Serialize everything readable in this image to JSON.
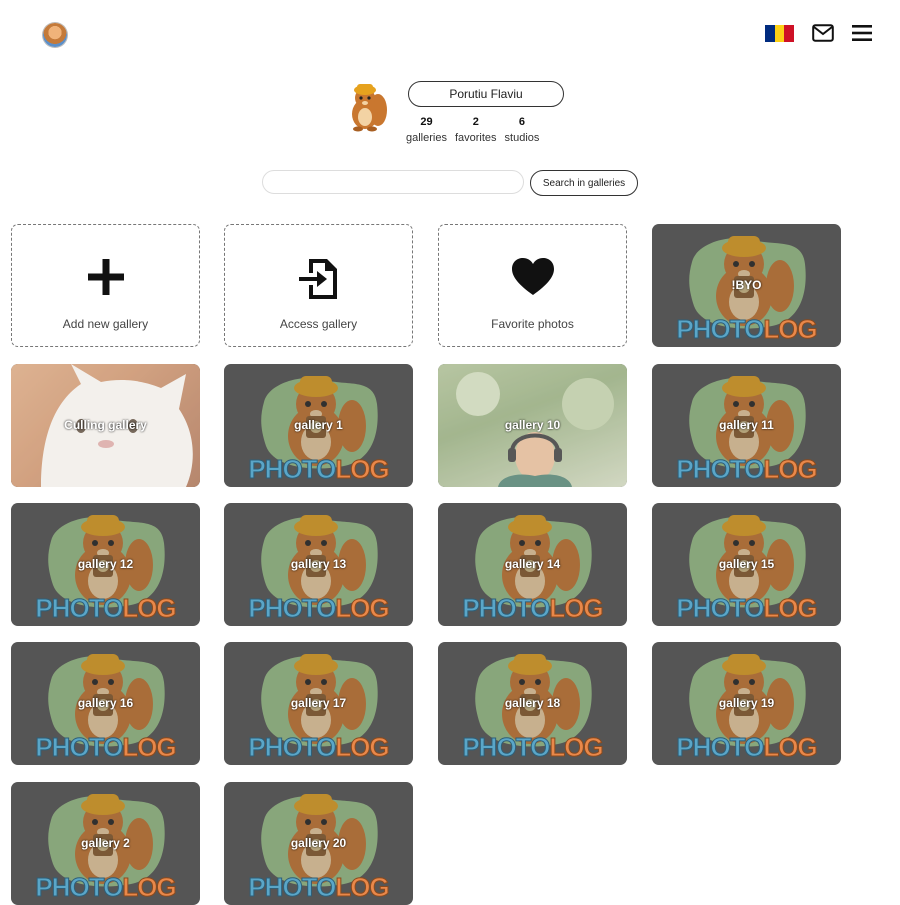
{
  "header": {
    "flag_colors": [
      "#002B7F",
      "#FCD116",
      "#CE1126"
    ],
    "icons": [
      "avatar",
      "flag-icon",
      "mail-icon",
      "menu-icon"
    ]
  },
  "profile": {
    "name": "Porutiu Flaviu",
    "stats": [
      {
        "value": "29",
        "label": "galleries"
      },
      {
        "value": "2",
        "label": "favorites"
      },
      {
        "value": "6",
        "label": "studios"
      }
    ]
  },
  "search": {
    "placeholder": "",
    "button_label": "Search in galleries"
  },
  "actions": [
    {
      "label": "Add new gallery",
      "icon": "plus-icon"
    },
    {
      "label": "Access gallery",
      "icon": "file-import-icon"
    },
    {
      "label": "Favorite photos",
      "icon": "heart-icon"
    }
  ],
  "galleries": [
    {
      "title": "!BYO",
      "thumb": "photolog-logo"
    },
    {
      "title": "Culling gallery",
      "thumb": "cat-photo"
    },
    {
      "title": "gallery 1",
      "thumb": "photolog-logo"
    },
    {
      "title": "gallery 10",
      "thumb": "person-photo"
    },
    {
      "title": "gallery 11",
      "thumb": "photolog-logo"
    },
    {
      "title": "gallery 12",
      "thumb": "photolog-logo"
    },
    {
      "title": "gallery 13",
      "thumb": "photolog-logo"
    },
    {
      "title": "gallery 14",
      "thumb": "photolog-logo"
    },
    {
      "title": "gallery 15",
      "thumb": "photolog-logo"
    },
    {
      "title": "gallery 16",
      "thumb": "photolog-logo"
    },
    {
      "title": "gallery 17",
      "thumb": "photolog-logo"
    },
    {
      "title": "gallery 18",
      "thumb": "photolog-logo"
    },
    {
      "title": "gallery 19",
      "thumb": "photolog-logo"
    },
    {
      "title": "gallery 2",
      "thumb": "photolog-logo"
    },
    {
      "title": "gallery 20",
      "thumb": "photolog-logo"
    }
  ],
  "logo_text": [
    "PHOTO",
    "LOG"
  ],
  "colors": {
    "tile_bg": "#555555",
    "logo_blob": "#9bc58a",
    "logo_photo": "#5aa6c8",
    "logo_log": "#e9884a",
    "mascot": "#c9772f",
    "hat": "#e6a21e"
  }
}
